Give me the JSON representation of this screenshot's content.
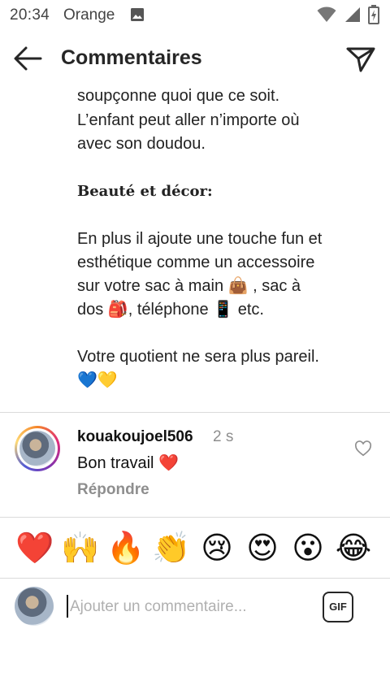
{
  "status_bar": {
    "time": "20:34",
    "carrier": "Orange"
  },
  "header": {
    "title": "Commentaires"
  },
  "caption": {
    "line1": "soupçonne quoi que ce soit.",
    "line2": "L’enfant peut aller n’importe où",
    "line3": "avec son doudou.",
    "heading": "Beauté et décor:",
    "p2_line1": "En plus il ajoute une touche fun et",
    "p2_line2": "esthétique comme un accessoire",
    "p2_line3": "sur votre sac à main 👜 , sac à",
    "p2_line4": "dos 🎒, téléphone 📱 etc.",
    "p3_line1": "Votre quotient ne sera plus pareil.",
    "p3_line2": "💙💛"
  },
  "comment": {
    "username": "kouakoujoel506",
    "time": "2 s",
    "text": "Bon travail ❤️",
    "reply_label": "Répondre"
  },
  "reactions": [
    "❤️",
    "🙌",
    "🔥",
    "👏",
    "😢",
    "😍",
    "😮",
    "😂"
  ],
  "composer": {
    "placeholder": "Ajouter un commentaire...",
    "gif_label": "GIF"
  }
}
